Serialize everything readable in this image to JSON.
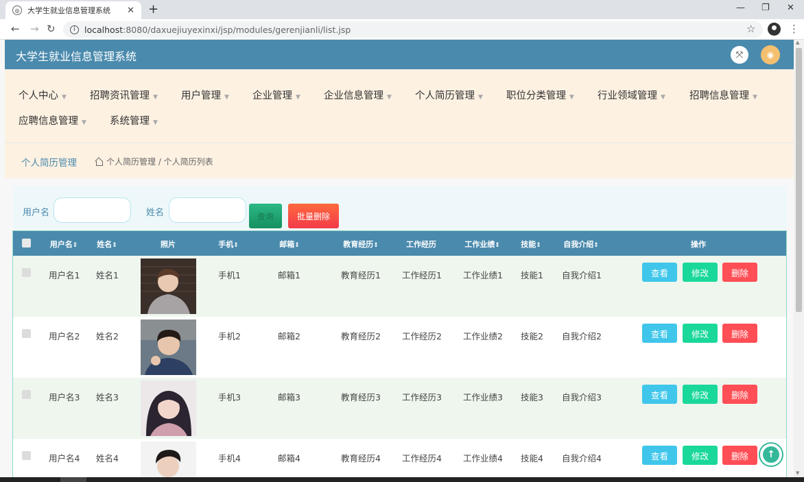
{
  "browser": {
    "tab_title": "大学生就业信息管理系统",
    "url_host": "localhost",
    "url_path": ":8080/daxuejiuyexinxi/jsp/modules/gerenjianli/list.jsp"
  },
  "app": {
    "title": "大学生就业信息管理系统",
    "nav": [
      "个人中心",
      "招聘资讯管理",
      "用户管理",
      "企业管理",
      "企业信息管理",
      "个人简历管理",
      "职位分类管理",
      "行业领域管理",
      "招聘信息管理",
      "应聘信息管理",
      "系统管理"
    ],
    "breadcrumb": {
      "title": "个人简历管理",
      "path": "个人简历管理 / 个人简历列表"
    }
  },
  "search": {
    "username_label": "用户名",
    "username_value": "",
    "name_label": "姓名",
    "name_value": "",
    "query_button": "查询",
    "batch_delete_button": "批量删除"
  },
  "table": {
    "headers": [
      "用户名",
      "姓名",
      "照片",
      "手机",
      "邮箱",
      "教育经历",
      "工作经历",
      "工作业绩",
      "技能",
      "自我介绍",
      "操作"
    ],
    "rows": [
      {
        "username": "用户名1",
        "name": "姓名1",
        "phone": "手机1",
        "email": "邮箱1",
        "education": "教育经历1",
        "work": "工作经历1",
        "achievement": "工作业绩1",
        "skill": "技能1",
        "intro": "自我介绍1"
      },
      {
        "username": "用户名2",
        "name": "姓名2",
        "phone": "手机2",
        "email": "邮箱2",
        "education": "教育经历2",
        "work": "工作经历2",
        "achievement": "工作业绩2",
        "skill": "技能2",
        "intro": "自我介绍2"
      },
      {
        "username": "用户名3",
        "name": "姓名3",
        "phone": "手机3",
        "email": "邮箱3",
        "education": "教育经历3",
        "work": "工作经历3",
        "achievement": "工作业绩3",
        "skill": "技能3",
        "intro": "自我介绍3"
      },
      {
        "username": "用户名4",
        "name": "姓名4",
        "phone": "手机4",
        "email": "邮箱4",
        "education": "教育经历4",
        "work": "工作经历4",
        "achievement": "工作业绩4",
        "skill": "技能4",
        "intro": "自我介绍4"
      }
    ],
    "actions": {
      "view": "查看",
      "edit": "修改",
      "delete": "删除"
    }
  },
  "colors": {
    "header_bg": "#4a8aad",
    "nav_bg": "#fdf1e2",
    "view_btn": "#3fc6ea",
    "edit_btn": "#1ad89a",
    "delete_btn": "#ff4e55"
  }
}
